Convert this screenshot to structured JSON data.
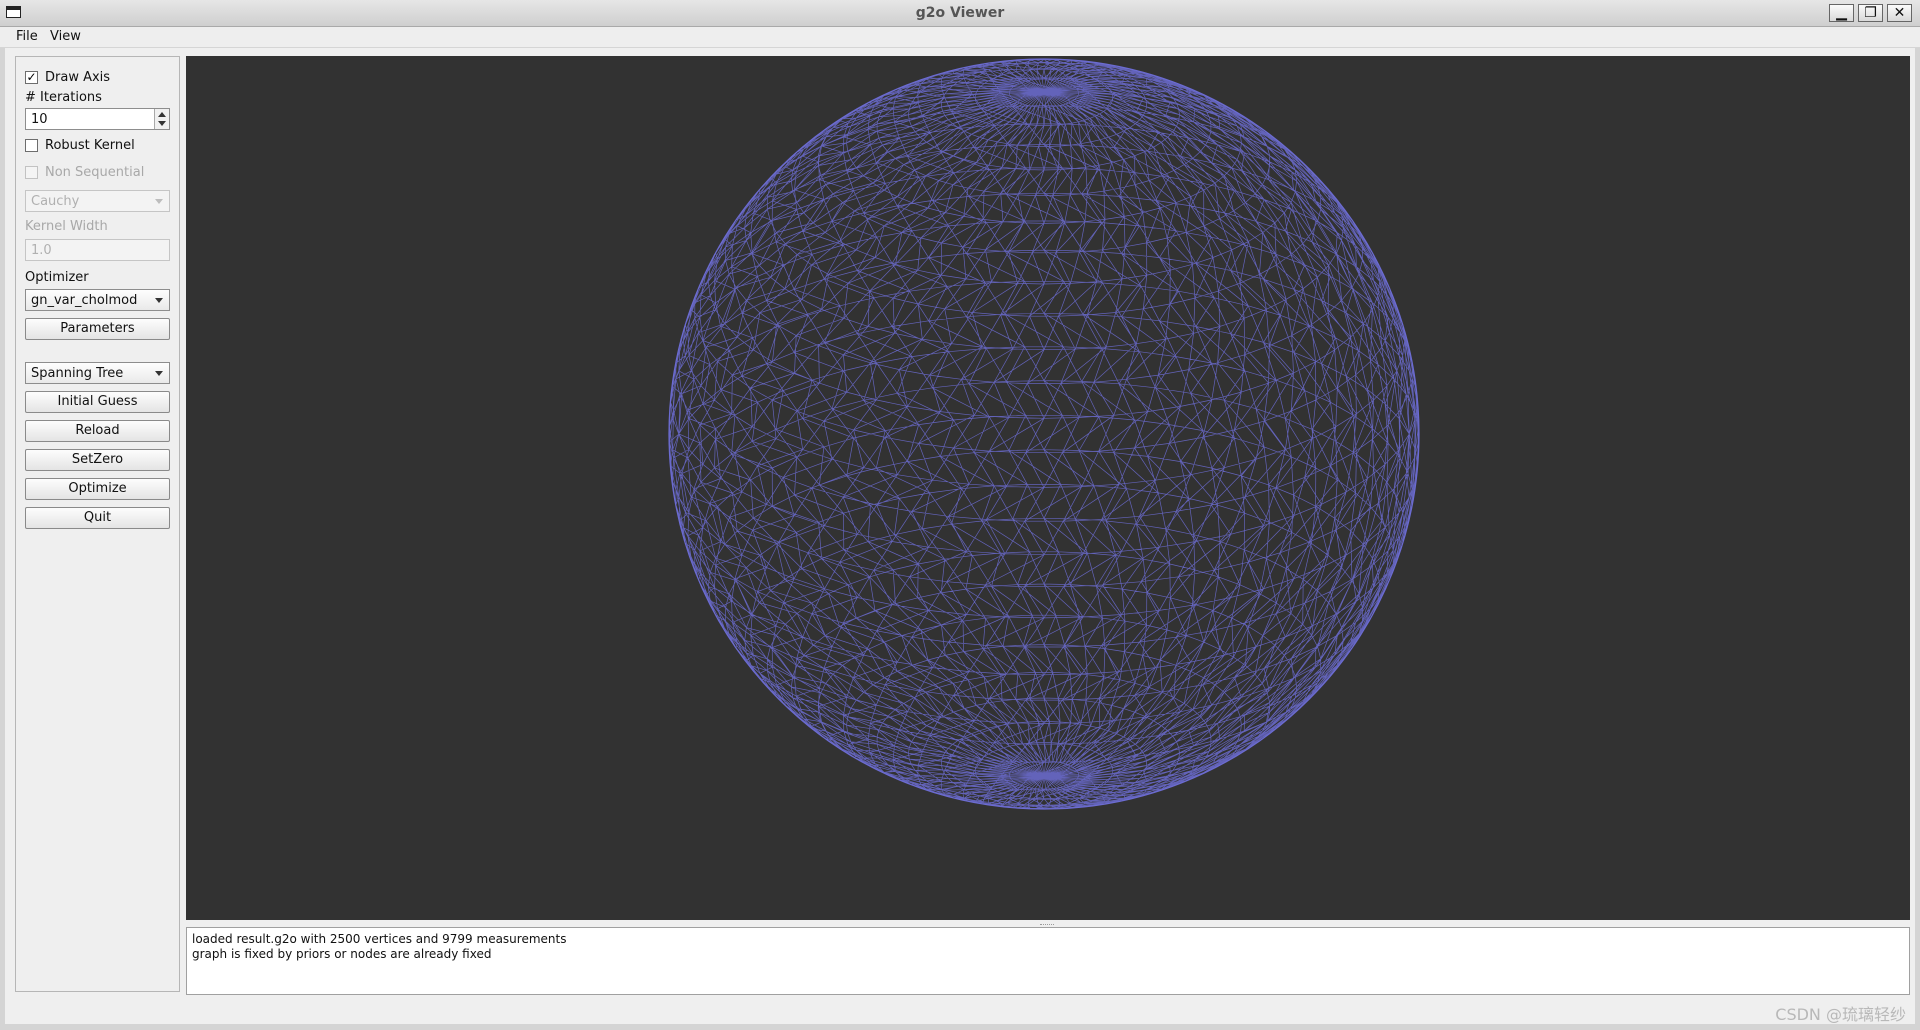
{
  "window": {
    "title": "g2o Viewer"
  },
  "menubar": {
    "items": [
      "File",
      "View"
    ]
  },
  "left_panel": {
    "draw_axis": {
      "label": "Draw Axis",
      "checked": true
    },
    "iterations": {
      "label": "# Iterations",
      "value": "10"
    },
    "robust_kernel": {
      "label": "Robust Kernel",
      "checked": false
    },
    "non_sequential": {
      "label": "Non Sequential",
      "checked": false,
      "enabled": false
    },
    "kernel_type": {
      "value": "Cauchy",
      "enabled": false
    },
    "kernel_width": {
      "label": "Kernel Width",
      "value": "1.0",
      "enabled": false
    },
    "optimizer": {
      "label": "Optimizer",
      "value": "gn_var_cholmod"
    },
    "parameters_button": "Parameters",
    "initial_guess_type": {
      "value": "Spanning Tree"
    },
    "buttons": {
      "initial_guess": "Initial Guess",
      "reload": "Reload",
      "set_zero": "SetZero",
      "optimize": "Optimize",
      "quit": "Quit"
    }
  },
  "viewport": {
    "background_color": "#323232",
    "mesh_color": "#6c6cd2",
    "content": "sphere-wireframe-graph"
  },
  "log": {
    "lines": [
      "loaded result.g2o with 2500 vertices and 9799 measurements",
      "graph is fixed by priors or nodes are already fixed"
    ]
  },
  "watermark": "CSDN @琉璃轻纱"
}
